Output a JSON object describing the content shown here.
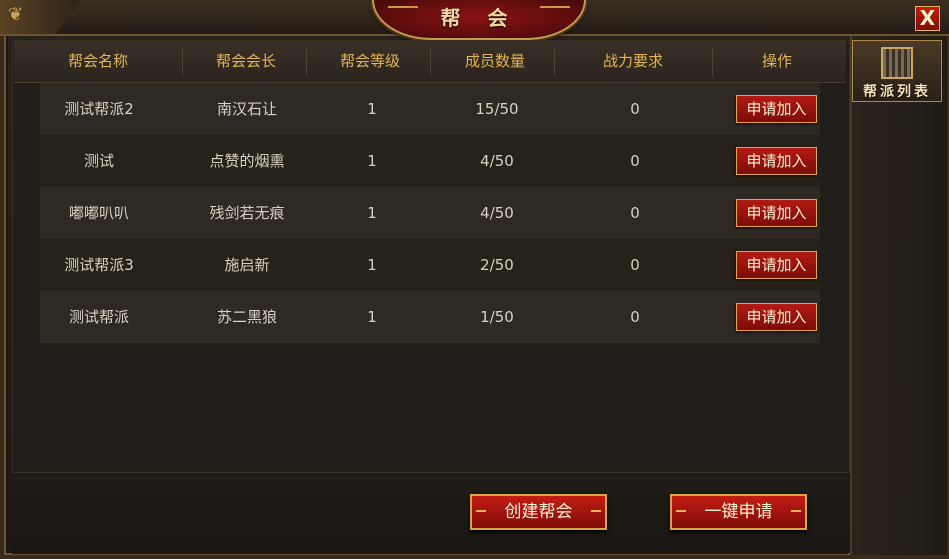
{
  "window": {
    "title": "帮 会",
    "close_label": "X"
  },
  "side_tab": {
    "label": "帮派列表"
  },
  "table": {
    "headers": [
      "帮会名称",
      "帮会会长",
      "帮会等级",
      "成员数量",
      "战力要求",
      "操作"
    ],
    "rows": [
      {
        "name": "测试帮派2",
        "leader": "南汉石让",
        "level": "1",
        "members": "15/50",
        "power": "0",
        "action": "申请加入"
      },
      {
        "name": "测试",
        "leader": "点赞的烟熏",
        "level": "1",
        "members": "4/50",
        "power": "0",
        "action": "申请加入"
      },
      {
        "name": "嘟嘟叭叭",
        "leader": "残剑若无痕",
        "level": "1",
        "members": "4/50",
        "power": "0",
        "action": "申请加入"
      },
      {
        "name": "测试帮派3",
        "leader": "施启新",
        "level": "1",
        "members": "2/50",
        "power": "0",
        "action": "申请加入"
      },
      {
        "name": "测试帮派",
        "leader": "苏二黑狼",
        "level": "1",
        "members": "1/50",
        "power": "0",
        "action": "申请加入"
      }
    ]
  },
  "footer": {
    "create_label": "创建帮会",
    "apply_all_label": "一键申请"
  }
}
